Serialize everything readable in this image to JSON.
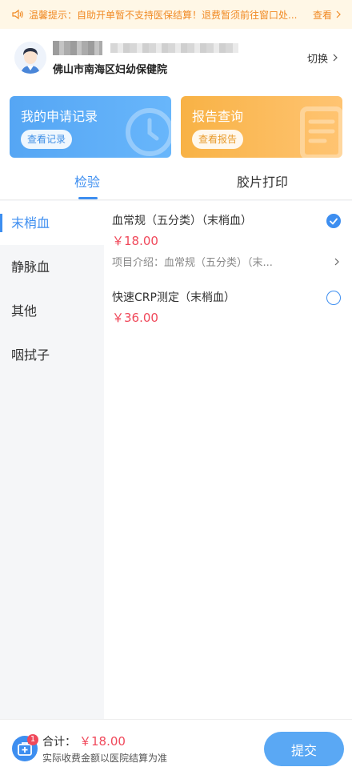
{
  "notice": {
    "text": "温馨提示：自助开单暂不支持医保结算！退费暂须前往窗口处...",
    "view_label": "查看"
  },
  "user": {
    "hospital": "佛山市南海区妇幼保健院",
    "switch_label": "切换"
  },
  "cards": [
    {
      "title": "我的申请记录",
      "button": "查看记录"
    },
    {
      "title": "报告查询",
      "button": "查看报告"
    }
  ],
  "tabs": [
    "检验",
    "胶片打印"
  ],
  "sidebar": {
    "items": [
      "末梢血",
      "静脉血",
      "其他",
      "咽拭子"
    ],
    "active_index": 0
  },
  "items": [
    {
      "name": "血常规（五分类）（末梢血）",
      "price": "￥18.00",
      "intro": "项目介绍：血常规（五分类）（末...",
      "selected": true
    },
    {
      "name": "快速CRP测定（末梢血）",
      "price": "￥36.00",
      "selected": false
    }
  ],
  "footer": {
    "cart_count": "1",
    "total_label": "合计：",
    "total_amount": "￥18.00",
    "note": "实际收费金额以医院结算为准",
    "submit": "提交"
  },
  "colors": {
    "primary": "#3d8ef0",
    "price": "#f0495b",
    "notice": "#f08a24"
  }
}
